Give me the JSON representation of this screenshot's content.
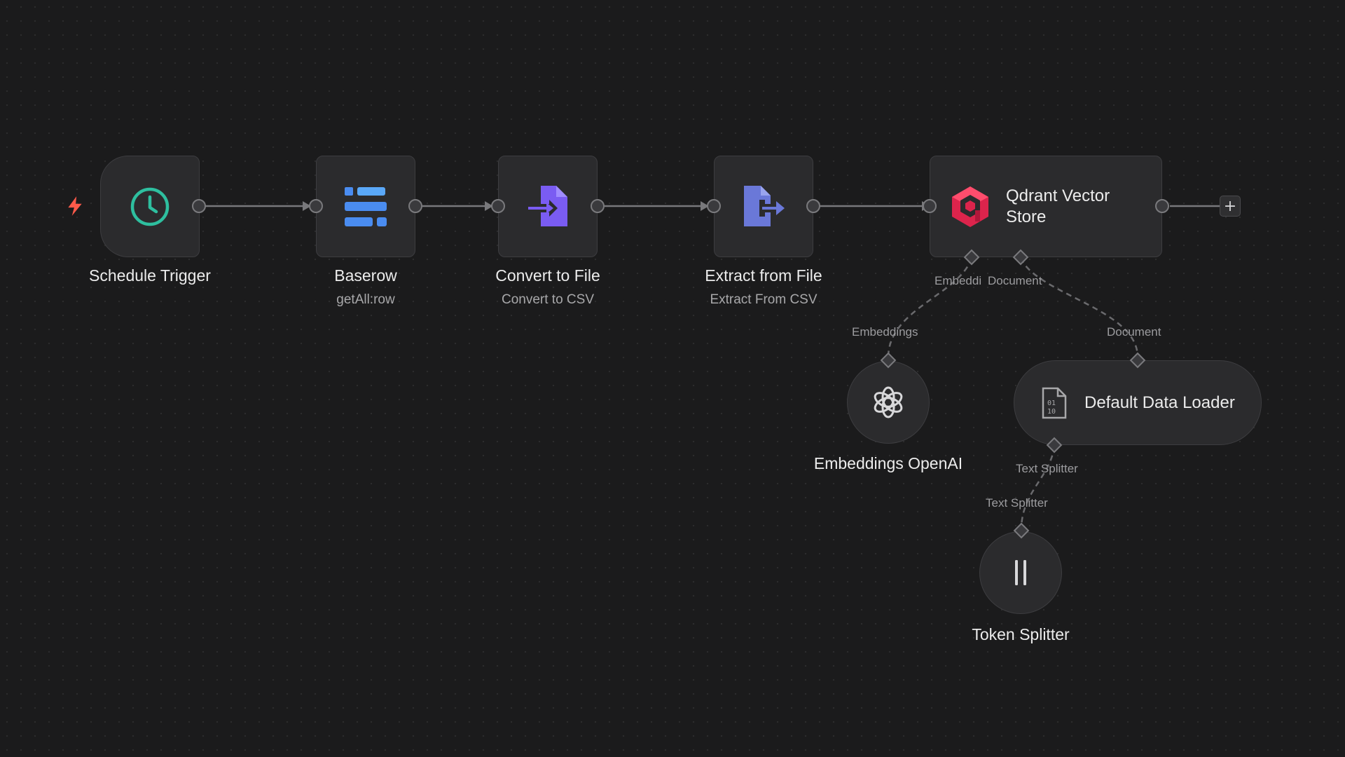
{
  "workflow": {
    "nodes": {
      "schedule_trigger": {
        "title": "Schedule Trigger"
      },
      "baserow": {
        "title": "Baserow",
        "subtitle": "getAll:row"
      },
      "convert_to_file": {
        "title": "Convert to File",
        "subtitle": "Convert to CSV"
      },
      "extract_from_file": {
        "title": "Extract from File",
        "subtitle": "Extract From CSV"
      },
      "qdrant": {
        "title_line1": "Qdrant Vector",
        "title_line2": "Store"
      },
      "embeddings_openai": {
        "title": "Embeddings OpenAI"
      },
      "default_data_loader": {
        "title": "Default Data Loader"
      },
      "token_splitter": {
        "title": "Token Splitter"
      }
    },
    "connection_labels": {
      "qdrant_embedding_port": "Embeddi",
      "qdrant_document_port": "Document",
      "embeddings_input": "Embeddings",
      "loader_input": "Document",
      "loader_text_splitter_port": "Text Splitter",
      "splitter_input": "Text Splitter"
    },
    "add_button": "+"
  },
  "icons": {
    "trigger_bolt": "lightning-icon",
    "schedule": "clock-icon",
    "baserow": "baserow-icon",
    "convert": "file-import-icon",
    "extract": "file-export-icon",
    "qdrant": "qdrant-icon",
    "openai": "openai-icon",
    "loader": "binary-file-icon",
    "splitter": "pause-bars-icon"
  },
  "colors": {
    "canvas_bg": "#1b1b1c",
    "node_bg": "#2b2b2d",
    "clock_green": "#2ebf9f",
    "baserow_blue": "#4a8cf0",
    "convert_purple": "#7a5cf2",
    "extract_indigo": "#6a78d8",
    "qdrant_red": "#dc244c",
    "bolt_red": "#ff5a4a"
  }
}
